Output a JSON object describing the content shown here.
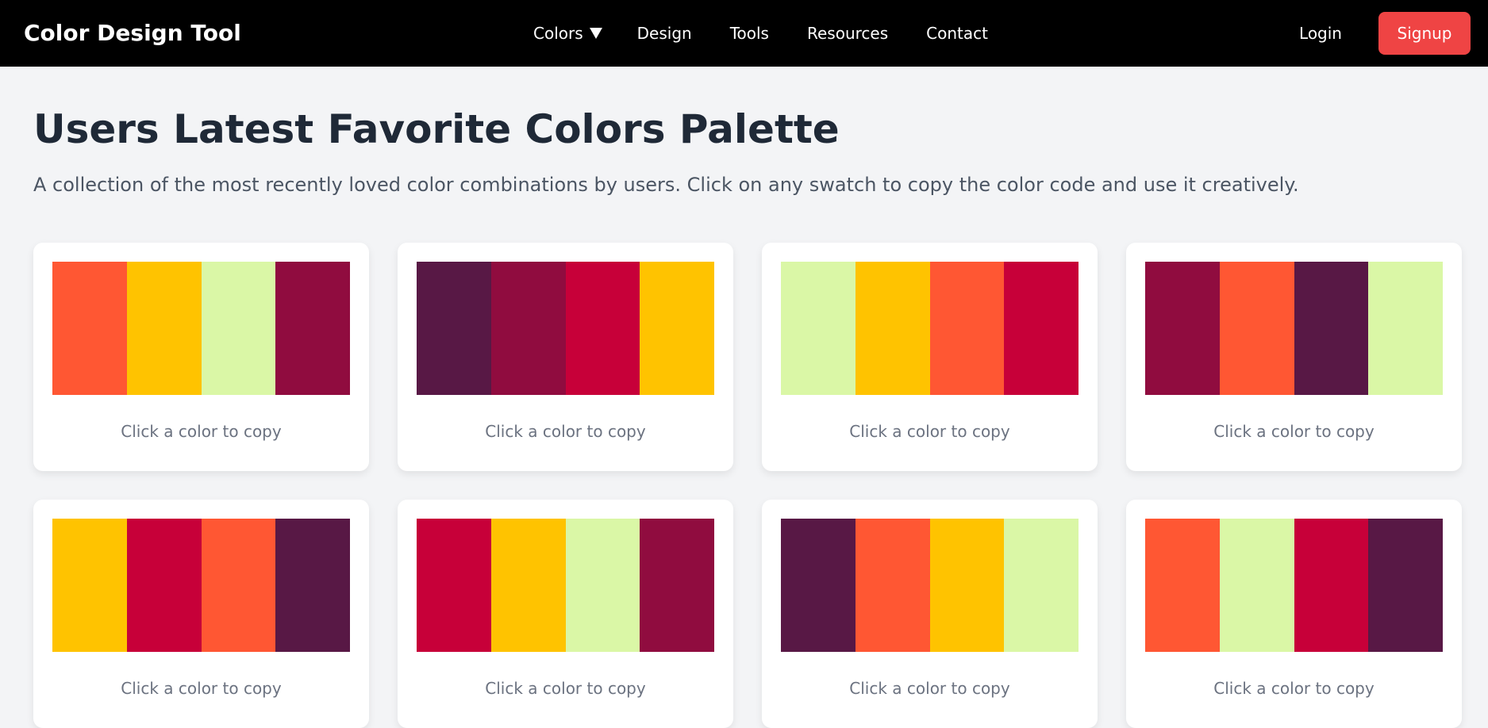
{
  "navbar": {
    "brand": "Color Design Tool",
    "links": [
      {
        "label": "Colors"
      },
      {
        "label": "Design"
      },
      {
        "label": "Tools"
      },
      {
        "label": "Resources"
      },
      {
        "label": "Contact"
      }
    ],
    "login_label": "Login",
    "signup_label": "Signup"
  },
  "header": {
    "title": "Users Latest Favorite Colors Palette",
    "subtitle": "A collection of the most recently loved color combinations by users. Click on any swatch to copy the color code and use it creatively."
  },
  "theme": {
    "navbar_bg": "#000000",
    "signup_bg": "#ef4444",
    "page_bg": "#f3f4f6"
  },
  "palettes": [
    {
      "hint": "Click a color to copy",
      "colors": [
        "#FF5733",
        "#FFC300",
        "#DAF7A6",
        "#900C3F"
      ]
    },
    {
      "hint": "Click a color to copy",
      "colors": [
        "#581845",
        "#900C3F",
        "#C70039",
        "#FFC300"
      ]
    },
    {
      "hint": "Click a color to copy",
      "colors": [
        "#DAF7A6",
        "#FFC300",
        "#FF5733",
        "#C70039"
      ]
    },
    {
      "hint": "Click a color to copy",
      "colors": [
        "#900C3F",
        "#FF5733",
        "#581845",
        "#DAF7A6"
      ]
    },
    {
      "hint": "Click a color to copy",
      "colors": [
        "#FFC300",
        "#C70039",
        "#FF5733",
        "#581845"
      ]
    },
    {
      "hint": "Click a color to copy",
      "colors": [
        "#C70039",
        "#FFC300",
        "#DAF7A6",
        "#900C3F"
      ]
    },
    {
      "hint": "Click a color to copy",
      "colors": [
        "#581845",
        "#FF5733",
        "#FFC300",
        "#DAF7A6"
      ]
    },
    {
      "hint": "Click a color to copy",
      "colors": [
        "#FF5733",
        "#DAF7A6",
        "#C70039",
        "#581845"
      ]
    }
  ]
}
